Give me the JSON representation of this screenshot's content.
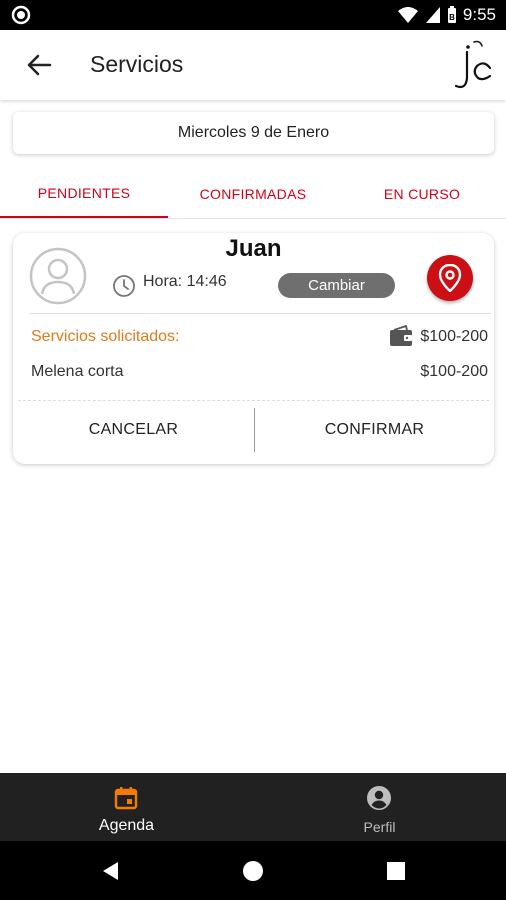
{
  "status_bar": {
    "time": "9:55"
  },
  "app_bar": {
    "title": "Servicios",
    "logo_text": "jc"
  },
  "date": {
    "label": "Miercoles 9 de Enero"
  },
  "tabs": [
    {
      "label": "PENDIENTES",
      "active": true
    },
    {
      "label": "CONFIRMADAS",
      "active": false
    },
    {
      "label": "EN CURSO",
      "active": false
    }
  ],
  "appointment": {
    "client_name": "Juan",
    "time_label": "Hora: 14:46",
    "change_button": "Cambiar",
    "services_label": "Servicios solicitados:",
    "price_range": "$100-200",
    "services": [
      {
        "name": "Melena corta",
        "price": "$100-200"
      }
    ],
    "cancel_label": "CANCELAR",
    "confirm_label": "CONFIRMAR"
  },
  "bottom_nav": [
    {
      "label": "Agenda",
      "icon": "calendar-icon",
      "active": true
    },
    {
      "label": "Perfil",
      "icon": "account-circle-icon",
      "active": false
    }
  ],
  "colors": {
    "accent_red": "#d0021b",
    "pin_red": "#cc0f15",
    "orange": "#e07a1c",
    "nav_bg": "#212121",
    "active_nav_icon": "#f57c00"
  }
}
